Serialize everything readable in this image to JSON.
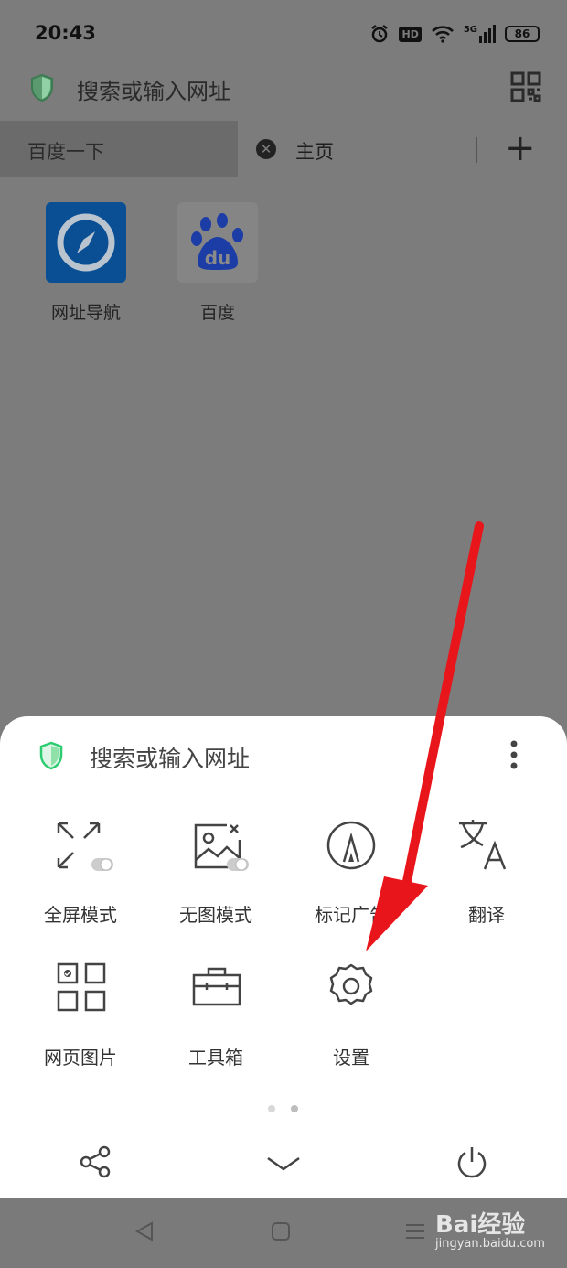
{
  "status": {
    "time": "20:43",
    "hd_badge": "HD",
    "network": "5G",
    "battery": "86"
  },
  "address_bar": {
    "placeholder": "搜索或输入网址"
  },
  "tabs": [
    {
      "label": "百度一下",
      "active": false
    },
    {
      "label": "主页",
      "active": true
    }
  ],
  "shortcuts": [
    {
      "label": "网址导航",
      "icon": "compass-icon"
    },
    {
      "label": "百度",
      "icon": "baidu-paw-icon",
      "icon_text": "du"
    }
  ],
  "sheet": {
    "address_placeholder": "搜索或输入网址",
    "menu_items": [
      {
        "label": "全屏模式",
        "icon": "fullscreen-icon"
      },
      {
        "label": "无图模式",
        "icon": "no-image-icon"
      },
      {
        "label": "标记广告",
        "icon": "mark-ad-icon"
      },
      {
        "label": "翻译",
        "icon": "translate-icon"
      },
      {
        "label": "网页图片",
        "icon": "web-images-icon"
      },
      {
        "label": "工具箱",
        "icon": "toolbox-icon"
      },
      {
        "label": "设置",
        "icon": "settings-icon"
      }
    ],
    "page_indicator": {
      "pages": 2,
      "current": 1
    }
  },
  "watermark": {
    "brand": "Bai经验",
    "url": "jingyan.baidu.com"
  },
  "colors": {
    "accent": "#2ecc71",
    "annotation_arrow": "#e8151b",
    "baidu_blue": "#2b4bd9",
    "nav_tile": "#0b64c0"
  }
}
